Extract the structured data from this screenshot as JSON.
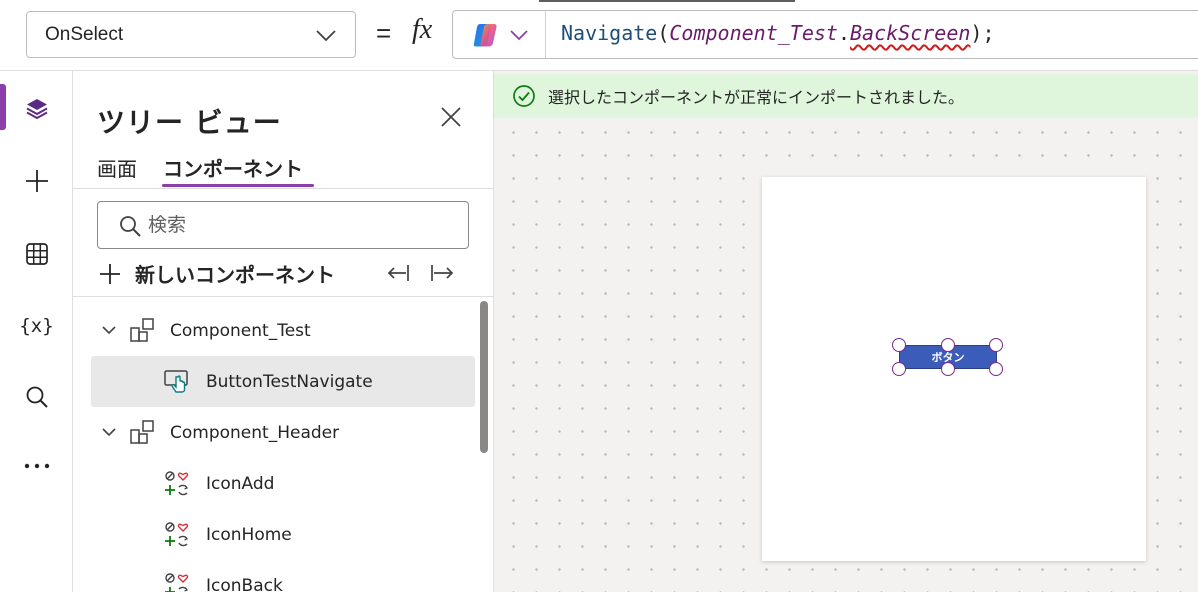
{
  "formula_bar": {
    "property": "OnSelect",
    "equals": "=",
    "fx_label": "fx",
    "formula": {
      "fn": "Navigate",
      "open_paren": "(",
      "component": "Component_Test",
      "dot": ".",
      "property_ref": "BackScreen",
      "close": ");"
    }
  },
  "rail": {
    "items": [
      {
        "icon": "layers-icon"
      },
      {
        "icon": "plus-icon"
      },
      {
        "icon": "data-grid-icon"
      },
      {
        "icon": "variables-icon",
        "text": "{x}"
      },
      {
        "icon": "search-icon"
      },
      {
        "icon": "more-icon",
        "text": "···"
      }
    ]
  },
  "tree": {
    "title": "ツリー ビュー",
    "tabs": {
      "screens": "画面",
      "components": "コンポーネント"
    },
    "search_placeholder": "検索",
    "new_component": "新しいコンポーネント",
    "items": [
      {
        "label": "Component_Test",
        "icon": "component-icon",
        "level": 0,
        "expanded": true
      },
      {
        "label": "ButtonTestNavigate",
        "icon": "button-icon",
        "level": 1,
        "selected": true
      },
      {
        "label": "Component_Header",
        "icon": "component-icon",
        "level": 0,
        "expanded": true
      },
      {
        "label": "IconAdd",
        "icon": "icon-control-icon",
        "level": 1
      },
      {
        "label": "IconHome",
        "icon": "icon-control-icon",
        "level": 1
      },
      {
        "label": "IconBack",
        "icon": "icon-control-icon",
        "level": 1
      }
    ]
  },
  "canvas": {
    "banner_text": "選択したコンポーネントが正常にインポートされました。",
    "button_label": "ボタン"
  },
  "colors": {
    "accent": "#8a3fab",
    "banner_bg": "#dff6dd",
    "success": "#107c10",
    "button_fill": "#3b5cb8",
    "error_underline": "#d11a1a"
  }
}
